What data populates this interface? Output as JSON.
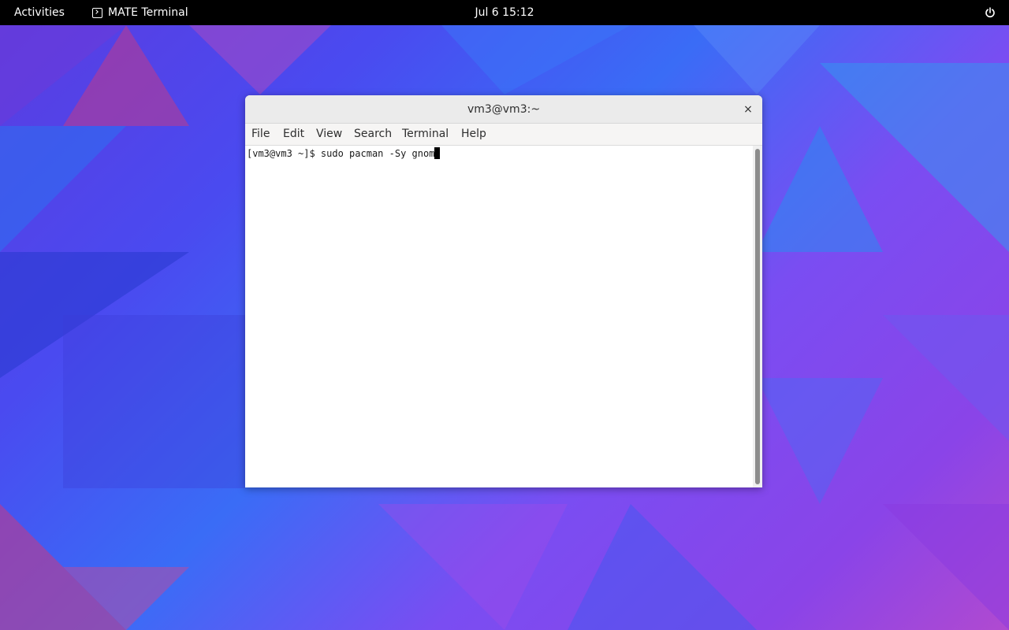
{
  "top_bar": {
    "activities_label": "Activities",
    "app_name": "MATE Terminal",
    "app_icon": "terminal-icon",
    "date": "Jul 6",
    "time": "15:12",
    "power_icon": "power-icon"
  },
  "window": {
    "title": "vm3@vm3:~",
    "close_label": "×",
    "menu": [
      "File",
      "Edit",
      "View",
      "Search",
      "Terminal",
      "Help"
    ]
  },
  "terminal": {
    "prompt": "[vm3@vm3 ~]$ ",
    "command": "sudo pacman -Sy gnom"
  },
  "colors": {
    "top_bar": "#000000",
    "titlebar": "#ebebeb",
    "menubar": "#f6f5f4",
    "terminal_bg": "#ffffff",
    "terminal_fg": "#1a1a1a"
  }
}
